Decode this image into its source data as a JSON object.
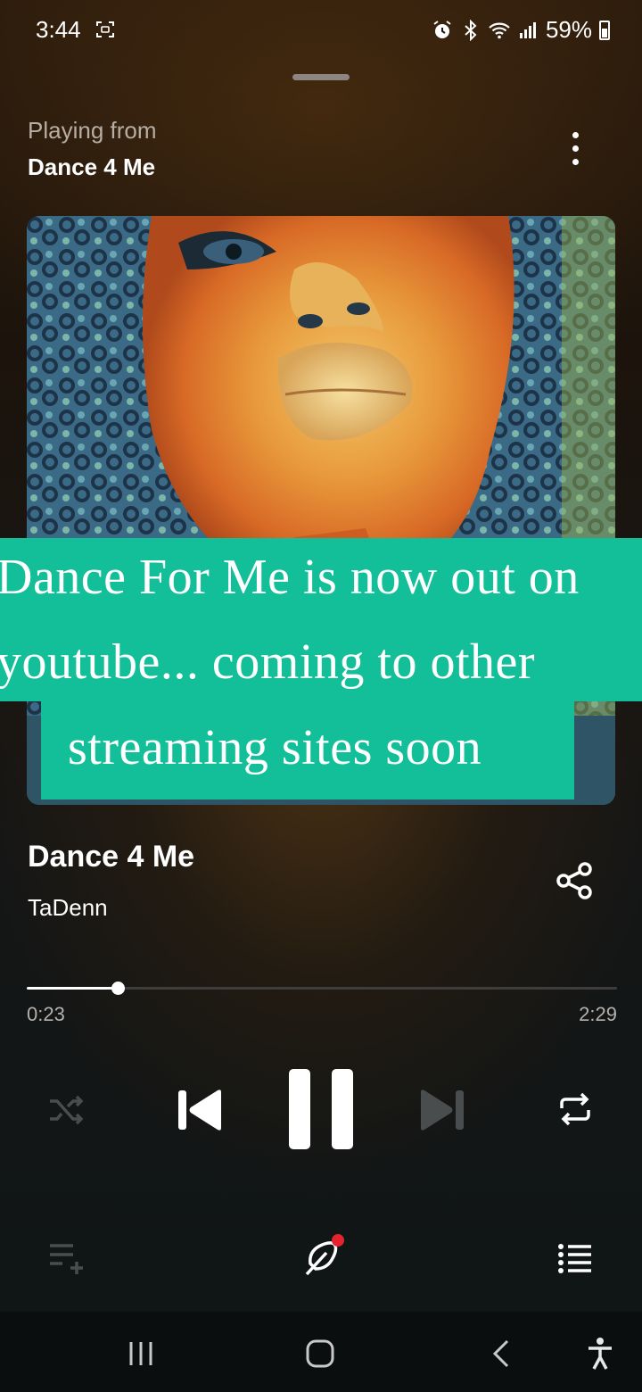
{
  "status_bar": {
    "time": "3:44",
    "battery": "59%",
    "icons": [
      "screenshot-icon",
      "alarm-icon",
      "bluetooth-icon",
      "wifi-icon",
      "signal-icon",
      "battery-icon"
    ]
  },
  "header": {
    "playing_from_label": "Playing from",
    "playlist_name": "Dance 4 Me",
    "more_icon": "more-vertical-icon"
  },
  "artwork": {
    "description_icon": "album-artwork"
  },
  "caption": {
    "line1": "Dance For Me is now out on",
    "line2": "youtube... coming to other",
    "line3": "streaming sites soon",
    "background_color": "#13bf98"
  },
  "track": {
    "title": "Dance 4 Me",
    "artist": "TaDenn"
  },
  "progress": {
    "elapsed": "0:23",
    "total": "2:29",
    "fraction": 0.1544
  },
  "controls": {
    "shuffle_icon": "shuffle-icon",
    "previous_icon": "skip-previous-icon",
    "pause_icon": "pause-icon",
    "next_icon": "skip-next-icon",
    "repeat_icon": "repeat-icon"
  },
  "bottom_actions": {
    "add_queue_icon": "playlist-add-icon",
    "edit_icon": "feather-pen-icon",
    "queue_icon": "queue-list-icon"
  },
  "nav_bar": {
    "icons": [
      "recent-apps-icon",
      "home-icon",
      "back-icon",
      "accessibility-icon"
    ]
  },
  "colors": {
    "accent_caption": "#13bf98",
    "notification_dot": "#e5232e",
    "muted_text": "#b5b0aa"
  }
}
